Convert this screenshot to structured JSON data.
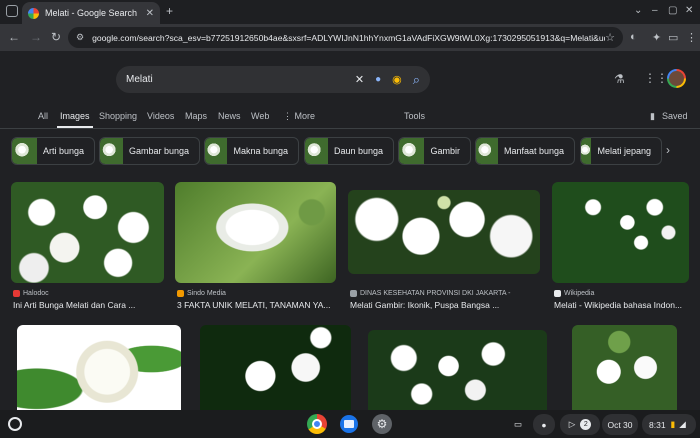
{
  "browser": {
    "tab_title": "Melati - Google Search",
    "new_tab": "+",
    "close_tab": "✕",
    "window_controls": [
      "⌄",
      "–",
      "▢",
      "✕"
    ],
    "url": "google.com/search?sca_esv=b77251912650b4ae&sxsrf=ADLYWIJnN1hhYnxmG1aVAdFiXGW9tWL0Xg:1730295051913&q=Melati&udm..."
  },
  "search": {
    "query": "Melati",
    "clear_icon": "✕",
    "mic_icon": "🎤",
    "lens_icon": "◉",
    "search_icon": "⌕"
  },
  "tabs": [
    {
      "label": "All"
    },
    {
      "label": "Images"
    },
    {
      "label": "Shopping"
    },
    {
      "label": "Videos"
    },
    {
      "label": "Maps"
    },
    {
      "label": "News"
    },
    {
      "label": "Web"
    },
    {
      "label": "⋮ More"
    }
  ],
  "tools_label": "Tools",
  "saved_label": "Saved",
  "chips": [
    {
      "label": "Arti bunga"
    },
    {
      "label": "Gambar bunga"
    },
    {
      "label": "Makna bunga"
    },
    {
      "label": "Daun bunga"
    },
    {
      "label": "Gambir"
    },
    {
      "label": "Manfaat bunga"
    },
    {
      "label": "Melati jepang"
    }
  ],
  "results": [
    {
      "source": "Halodoc",
      "caption": "Ini Arti Bunga Melati dan Cara ..."
    },
    {
      "source": "Sindo Media",
      "caption": "3 FAKTA UNIK MELATI, TANAMAN YA..."
    },
    {
      "source": "DINAS KESEHATAN PROVINSI DKI JAKARTA -",
      "caption": "Melati Gambir: Ikonik, Puspa Bangsa ..."
    },
    {
      "source": "Wikipedia",
      "caption": "Melati - Wikipedia bahasa Indon..."
    }
  ],
  "shelf": {
    "date": "Oct 30",
    "time": "8:31",
    "notif_count": "2"
  },
  "colors": {
    "background": "#202124",
    "accent": "#8ab4f8"
  }
}
